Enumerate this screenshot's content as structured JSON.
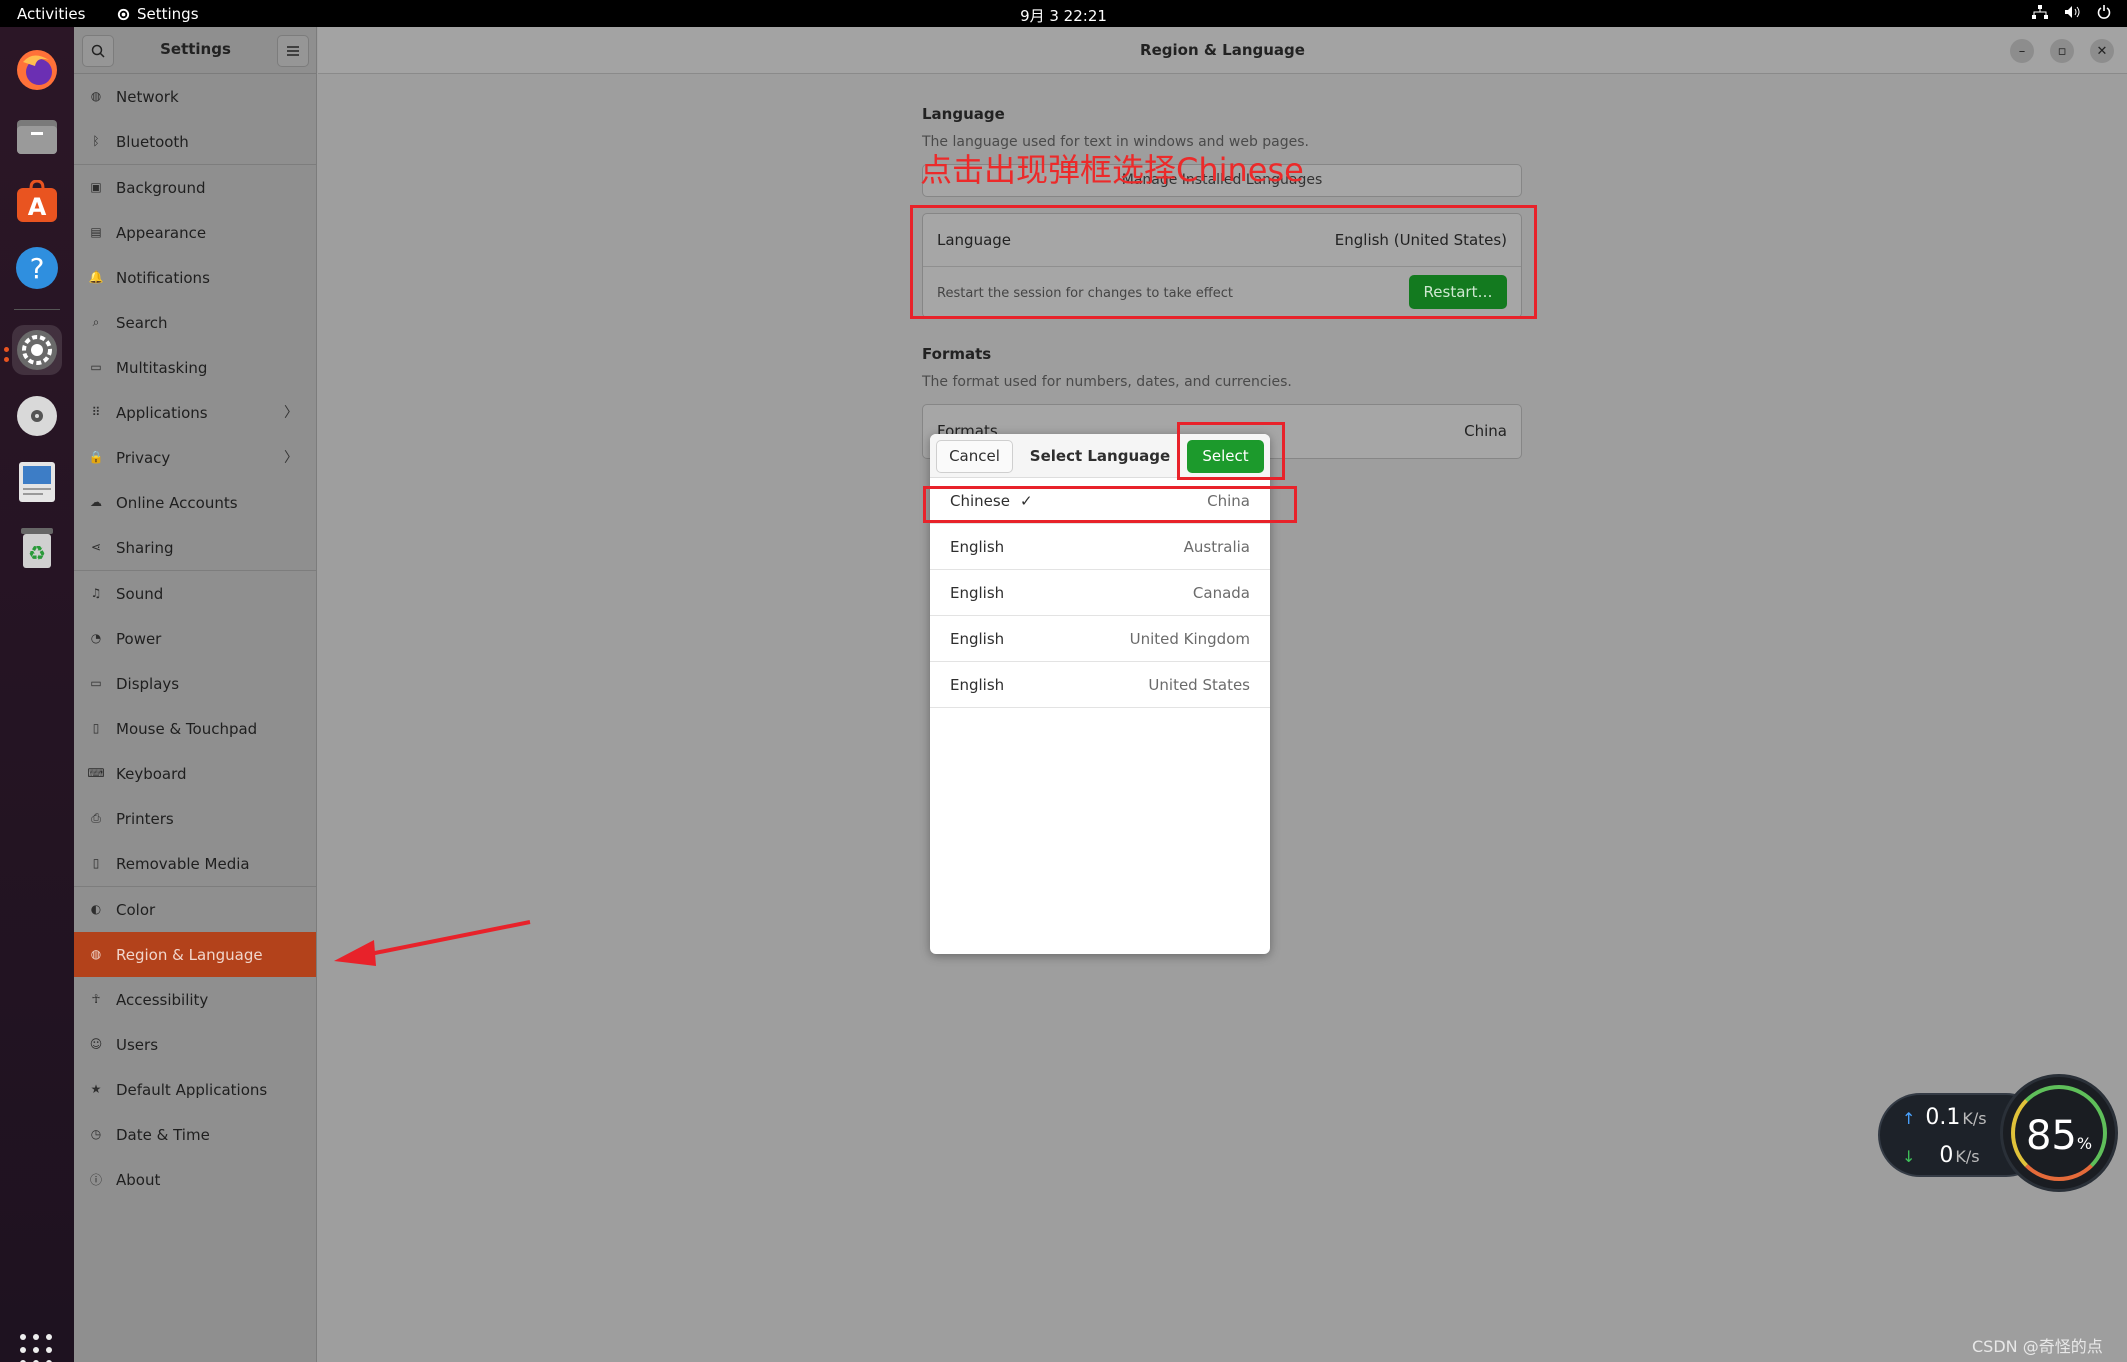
{
  "topbar": {
    "activities": "Activities",
    "app_name": "Settings",
    "clock": "9月 3  22:21"
  },
  "dock": {
    "apps": [
      "firefox-icon",
      "files-icon",
      "app-center-icon",
      "help-icon",
      "settings-icon",
      "disc-icon",
      "text-editor-icon",
      "trash-icon"
    ]
  },
  "sidebar": {
    "title": "Settings",
    "items": [
      {
        "label": "Network",
        "icon": "network-icon"
      },
      {
        "label": "Bluetooth",
        "icon": "bluetooth-icon"
      },
      {
        "label": "Background",
        "icon": "background-icon"
      },
      {
        "label": "Appearance",
        "icon": "appearance-icon"
      },
      {
        "label": "Notifications",
        "icon": "bell-icon"
      },
      {
        "label": "Search",
        "icon": "search-icon"
      },
      {
        "label": "Multitasking",
        "icon": "multitasking-icon"
      },
      {
        "label": "Applications",
        "icon": "grid-icon"
      },
      {
        "label": "Privacy",
        "icon": "lock-icon"
      },
      {
        "label": "Online Accounts",
        "icon": "cloud-icon"
      },
      {
        "label": "Sharing",
        "icon": "share-icon"
      },
      {
        "label": "Sound",
        "icon": "music-icon"
      },
      {
        "label": "Power",
        "icon": "power-icon"
      },
      {
        "label": "Displays",
        "icon": "display-icon"
      },
      {
        "label": "Mouse & Touchpad",
        "icon": "mouse-icon"
      },
      {
        "label": "Keyboard",
        "icon": "keyboard-icon"
      },
      {
        "label": "Printers",
        "icon": "printer-icon"
      },
      {
        "label": "Removable Media",
        "icon": "media-icon"
      },
      {
        "label": "Color",
        "icon": "color-icon"
      },
      {
        "label": "Region & Language",
        "icon": "globe-icon"
      },
      {
        "label": "Accessibility",
        "icon": "accessibility-icon"
      },
      {
        "label": "Users",
        "icon": "users-icon"
      },
      {
        "label": "Default Applications",
        "icon": "star-icon"
      },
      {
        "label": "Date & Time",
        "icon": "clock-icon"
      },
      {
        "label": "About",
        "icon": "info-icon"
      }
    ]
  },
  "main": {
    "title": "Region & Language",
    "language_section": {
      "title": "Language",
      "desc": "The language used for text in windows and web pages.",
      "manage_button": "Manage Installed Languages",
      "row_label": "Language",
      "row_value": "English (United States)",
      "restart_note": "Restart the session for changes to take effect",
      "restart_button": "Restart…"
    },
    "formats_section": {
      "title": "Formats",
      "desc": "The format used for numbers, dates, and currencies.",
      "row_label": "Formats",
      "row_value": "China"
    }
  },
  "annotation": {
    "text": "点击出现弹框选择Chinese",
    "color": "#ec2a2a"
  },
  "dialog": {
    "cancel": "Cancel",
    "title": "Select Language",
    "select": "Select",
    "languages": [
      {
        "name": "Chinese",
        "country": "China",
        "selected": true
      },
      {
        "name": "English",
        "country": "Australia",
        "selected": false
      },
      {
        "name": "English",
        "country": "Canada",
        "selected": false
      },
      {
        "name": "English",
        "country": "United Kingdom",
        "selected": false
      },
      {
        "name": "English",
        "country": "United States",
        "selected": false
      }
    ]
  },
  "net_widget": {
    "upload": "0.1",
    "upload_unit": "K/s",
    "download": "0",
    "download_unit": "K/s",
    "cpu": "85",
    "cpu_unit": "%"
  },
  "watermark": "CSDN @奇怪的点",
  "colors": {
    "accent": "#b3421b",
    "select_green": "#1c9a2c",
    "annotation_red": "#e8222a"
  }
}
